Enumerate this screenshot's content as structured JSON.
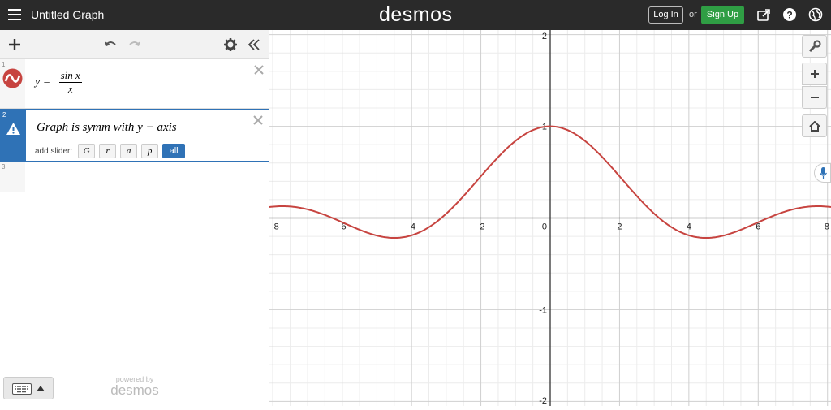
{
  "header": {
    "title": "Untitled Graph",
    "brand": "desmos",
    "login_label": "Log In",
    "or_text": "or",
    "signup_label": "Sign Up"
  },
  "expressions": [
    {
      "index": "1",
      "lhs": "y =",
      "num": "sin x",
      "den": "x"
    },
    {
      "index": "2",
      "text": "Graph is symm with y − axis",
      "slider_label": "add slider:",
      "sliders": [
        "G",
        "r",
        "a",
        "p",
        "all"
      ]
    },
    {
      "index": "3"
    }
  ],
  "footer": {
    "powered_by": "powered by",
    "brand": "desmos"
  },
  "graph": {
    "x_ticks": [
      "-8",
      "-6",
      "-4",
      "-2",
      "0",
      "2",
      "4",
      "6",
      "8"
    ],
    "y_ticks": [
      "2",
      "1",
      "-1",
      "-2"
    ],
    "x_range": [
      -8.1,
      8.1
    ],
    "y_range": [
      -2.05,
      2.05
    ],
    "curve_color": "#c74440",
    "function": "sin(x)/x"
  },
  "colors": {
    "topbar": "#2a2a2a",
    "signup": "#2f9e44",
    "accent": "#2f72b6",
    "curve": "#c74440"
  }
}
